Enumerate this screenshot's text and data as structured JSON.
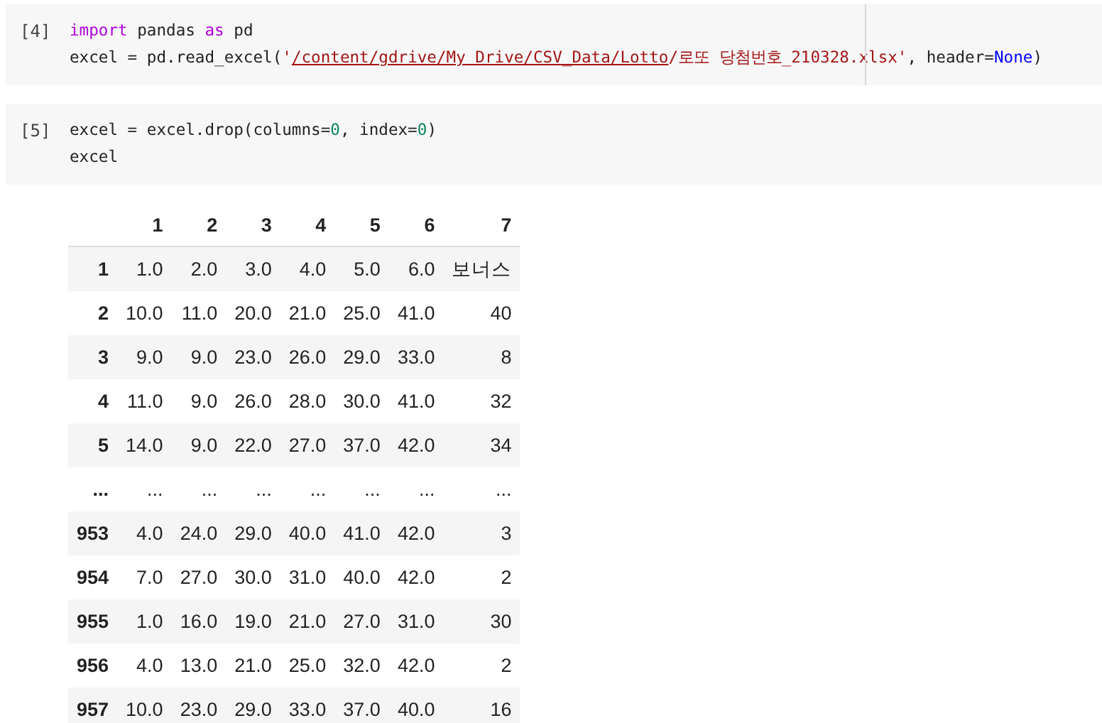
{
  "cells": [
    {
      "prompt": "[4]",
      "lines": [
        [
          {
            "kind": "keyword",
            "text": "import"
          },
          {
            "kind": "plain",
            "text": " pandas "
          },
          {
            "kind": "keyword",
            "text": "as"
          },
          {
            "kind": "plain",
            "text": " pd"
          }
        ],
        [
          {
            "kind": "plain",
            "text": "excel = pd.read_excel("
          },
          {
            "kind": "string",
            "text": "'"
          },
          {
            "kind": "link",
            "text": "/content/gdrive/My Drive/CSV_Data/Lotto"
          },
          {
            "kind": "string",
            "text": "/로또 당첨번호_210328.xlsx'"
          },
          {
            "kind": "plain",
            "text": ", header="
          },
          {
            "kind": "constant",
            "text": "None"
          },
          {
            "kind": "plain",
            "text": ")"
          }
        ]
      ]
    },
    {
      "prompt": "[5]",
      "lines": [
        [
          {
            "kind": "plain",
            "text": "excel = excel.drop(columns="
          },
          {
            "kind": "number",
            "text": "0"
          },
          {
            "kind": "plain",
            "text": ", index="
          },
          {
            "kind": "number",
            "text": "0"
          },
          {
            "kind": "plain",
            "text": ")"
          }
        ],
        [
          {
            "kind": "plain",
            "text": "excel"
          }
        ]
      ]
    }
  ],
  "table": {
    "columns": [
      "",
      "1",
      "2",
      "3",
      "4",
      "5",
      "6",
      "7"
    ],
    "rows": [
      [
        "1",
        "1.0",
        "2.0",
        "3.0",
        "4.0",
        "5.0",
        "6.0",
        "보너스"
      ],
      [
        "2",
        "10.0",
        "11.0",
        "20.0",
        "21.0",
        "25.0",
        "41.0",
        "40"
      ],
      [
        "3",
        "9.0",
        "9.0",
        "23.0",
        "26.0",
        "29.0",
        "33.0",
        "8"
      ],
      [
        "4",
        "11.0",
        "9.0",
        "26.0",
        "28.0",
        "30.0",
        "41.0",
        "32"
      ],
      [
        "5",
        "14.0",
        "9.0",
        "22.0",
        "27.0",
        "37.0",
        "42.0",
        "34"
      ],
      [
        "...",
        "...",
        "...",
        "...",
        "...",
        "...",
        "...",
        "..."
      ],
      [
        "953",
        "4.0",
        "24.0",
        "29.0",
        "40.0",
        "41.0",
        "42.0",
        "3"
      ],
      [
        "954",
        "7.0",
        "27.0",
        "30.0",
        "31.0",
        "40.0",
        "42.0",
        "2"
      ],
      [
        "955",
        "1.0",
        "16.0",
        "19.0",
        "21.0",
        "27.0",
        "31.0",
        "30"
      ],
      [
        "956",
        "4.0",
        "13.0",
        "21.0",
        "25.0",
        "32.0",
        "42.0",
        "2"
      ],
      [
        "957",
        "10.0",
        "23.0",
        "29.0",
        "33.0",
        "37.0",
        "40.0",
        "16"
      ]
    ]
  }
}
